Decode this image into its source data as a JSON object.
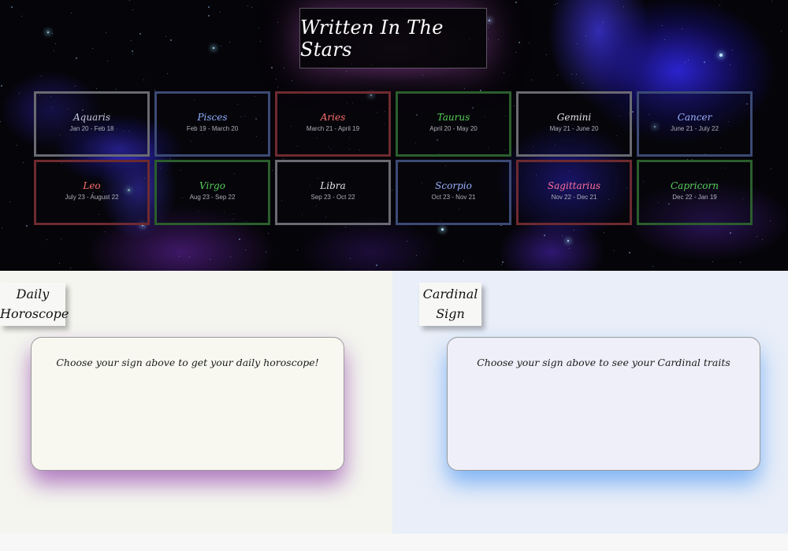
{
  "header": {
    "title": "Written In The Stars"
  },
  "signs": [
    {
      "name": "Aquaris",
      "dates": "Jan 20 - Feb 18",
      "color": "#c9cbe2",
      "border": "#6a6a72"
    },
    {
      "name": "Pisces",
      "dates": "Feb 19 - March 20",
      "color": "#8fb0ff",
      "border": "#3c4a74"
    },
    {
      "name": "Aries",
      "dates": "March 21 - April 19",
      "color": "#ff6f6f",
      "border": "#6e2a30"
    },
    {
      "name": "Taurus",
      "dates": "April 20 - May 20",
      "color": "#57d15a",
      "border": "#2b5e2d"
    },
    {
      "name": "Gemini",
      "dates": "May 21 - June 20",
      "color": "#e6e6ea",
      "border": "#6a6a72"
    },
    {
      "name": "Cancer",
      "dates": "June 21 - July 22",
      "color": "#9ab2ff",
      "border": "#3c4a74"
    },
    {
      "name": "Leo",
      "dates": "July 23 - August 22",
      "color": "#ff6f6f",
      "border": "#6e2a30"
    },
    {
      "name": "Virgo",
      "dates": "Aug 23 - Sep 22",
      "color": "#57d15a",
      "border": "#2b5e2d"
    },
    {
      "name": "Libra",
      "dates": "Sep 23 - Oct 22",
      "color": "#e6e6ea",
      "border": "#6a6a72"
    },
    {
      "name": "Scorpio",
      "dates": "Oct 23 - Nov 21",
      "color": "#9ab2ff",
      "border": "#3c4a74"
    },
    {
      "name": "Sagittarius",
      "dates": "Nov 22 - Dec 21",
      "color": "#ff6f9a",
      "border": "#6e2a30"
    },
    {
      "name": "Capricorn",
      "dates": "Dec 22 - Jan 19",
      "color": "#57d15a",
      "border": "#2b5e2d"
    }
  ],
  "daily": {
    "heading_line1": "Daily",
    "heading_line2": "Horoscope",
    "prompt": "Choose your sign above to get your daily horoscope!",
    "glow_color": "#b07ac0"
  },
  "cardinal": {
    "heading_line1": "Cardinal",
    "heading_line2": "Sign",
    "prompt": "Choose your sign above to see your Cardinal traits",
    "glow_color": "#7fb4f5"
  }
}
